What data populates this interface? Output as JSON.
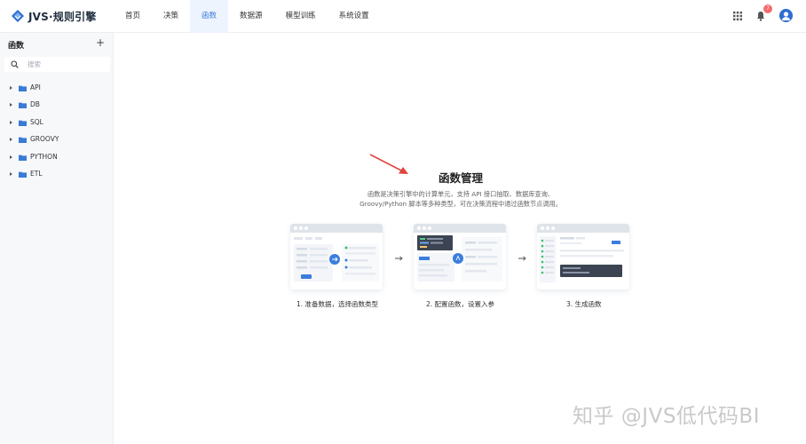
{
  "app": {
    "logo_text": "JVS·规则引擎",
    "brand_color": "#2f6fd1"
  },
  "nav": {
    "tabs": [
      {
        "label": "首页",
        "active": false
      },
      {
        "label": "决策",
        "active": false
      },
      {
        "label": "函数",
        "active": true
      },
      {
        "label": "数据源",
        "active": false
      },
      {
        "label": "模型训练",
        "active": false
      },
      {
        "label": "系统设置",
        "active": false
      }
    ]
  },
  "header_right": {
    "apps_icon": "grid-icon",
    "notifications_icon": "bell-icon",
    "notification_count": "7",
    "avatar_icon": "user-avatar-icon"
  },
  "sidebar": {
    "title": "函数",
    "add_icon": "plus-icon",
    "search": {
      "placeholder": "搜索",
      "value": ""
    },
    "items": [
      {
        "label": "API"
      },
      {
        "label": "DB"
      },
      {
        "label": "SQL"
      },
      {
        "label": "GROOVY"
      },
      {
        "label": "PYTHON"
      },
      {
        "label": "ETL"
      }
    ]
  },
  "main": {
    "title": "函数管理",
    "description_line1": "函数是决策引擎中的计算单元，支持 API 接口抽取、数据库查询、",
    "description_line2": "Groovy/Python 脚本等多种类型，可在决策流程中通过函数节点调用。",
    "steps": [
      {
        "label": "1. 准备数据，选择函数类型"
      },
      {
        "label": "2. 配置函数，设置入参"
      },
      {
        "label": "3. 生成函数"
      }
    ],
    "annotation_arrow_color": "#e0443e"
  },
  "watermark": "知乎 @JVS低代码BI"
}
